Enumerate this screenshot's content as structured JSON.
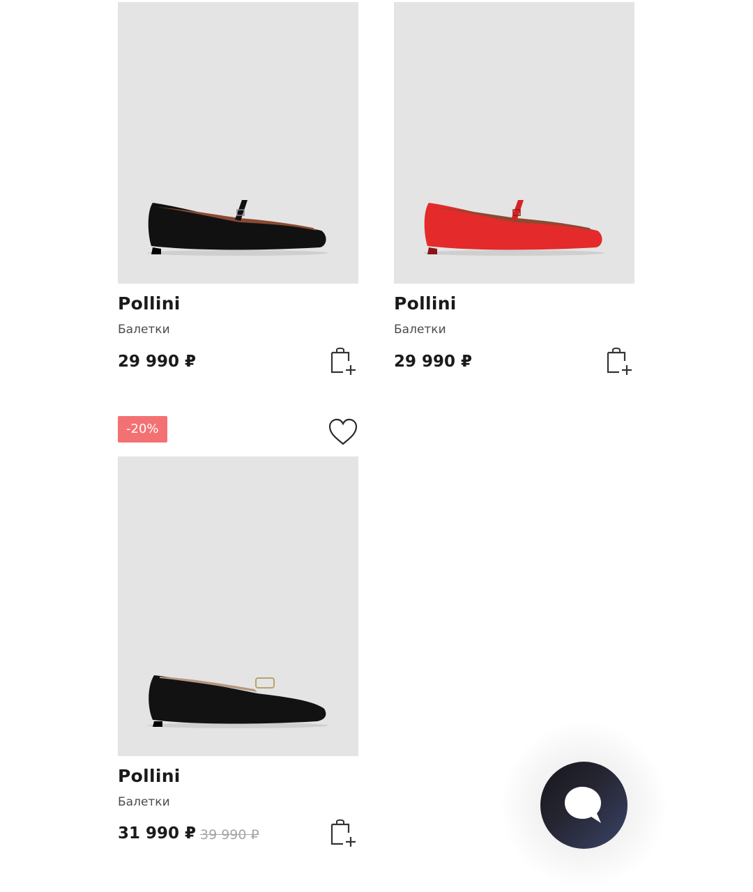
{
  "products": [
    {
      "brand": "Pollini",
      "category": "Балетки",
      "price": "29 990 ₽",
      "shoe_color": "#111111"
    },
    {
      "brand": "Pollini",
      "category": "Балетки",
      "price": "29 990 ₽",
      "shoe_color": "#e42a2a"
    },
    {
      "badge": "-20%",
      "brand": "Pollini",
      "category": "Балетки",
      "price": "31 990 ₽",
      "old_price": "39 990 ₽",
      "shoe_color": "#111111"
    }
  ],
  "icons": {
    "cart": "shopping-bag-plus-icon",
    "favorite": "heart-outline-icon",
    "chat": "chat-bubble-icon"
  },
  "colors": {
    "photo_bg": "#e4e4e4",
    "badge_bg": "#f47173",
    "chat_button": "#1f1f28"
  }
}
